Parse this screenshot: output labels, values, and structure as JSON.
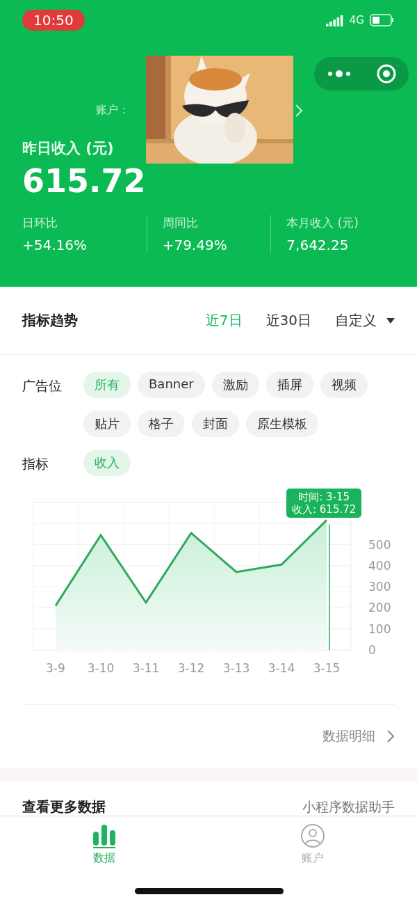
{
  "status_bar": {
    "time": "10:50",
    "network": "4G"
  },
  "header": {
    "account_label": "账户：",
    "yesterday_label": "昨日收入 (元)",
    "yesterday_value": "615.72",
    "stats": [
      {
        "label": "日环比",
        "value": "+54.16%"
      },
      {
        "label": "周同比",
        "value": "+79.49%"
      },
      {
        "label": "本月收入 (元)",
        "value": "7,642.25"
      }
    ]
  },
  "trend": {
    "title": "指标趋势",
    "ranges": [
      {
        "label": "近7日",
        "selected": true
      },
      {
        "label": "近30日",
        "selected": false
      },
      {
        "label": "自定义",
        "selected": false
      }
    ]
  },
  "filters": [
    {
      "label": "广告位",
      "chips": [
        {
          "label": "所有",
          "selected": true
        },
        {
          "label": "Banner",
          "selected": false
        },
        {
          "label": "激励",
          "selected": false
        },
        {
          "label": "插屏",
          "selected": false
        },
        {
          "label": "视频",
          "selected": false
        },
        {
          "label": "贴片",
          "selected": false
        },
        {
          "label": "格子",
          "selected": false
        },
        {
          "label": "封面",
          "selected": false
        },
        {
          "label": "原生模板",
          "selected": false
        }
      ]
    },
    {
      "label": "指标",
      "chips": [
        {
          "label": "收入",
          "selected": true
        }
      ]
    }
  ],
  "chart": {
    "tooltip": [
      "时间: 3-15",
      "收入: 615.72"
    ],
    "chart_data": {
      "type": "area",
      "categories": [
        "3-9",
        "3-10",
        "3-11",
        "3-12",
        "3-13",
        "3-14",
        "3-15"
      ],
      "series": [
        {
          "color": "#2eaa5c",
          "values": [
            210,
            545,
            225,
            555,
            370,
            405,
            616
          ]
        }
      ],
      "ylim": [
        0,
        700
      ],
      "yticks": [
        0,
        100,
        200,
        300,
        400,
        500
      ],
      "grid": true,
      "ref_lines": [
        {
          "axis": "x",
          "value": "3-15",
          "color": "#18b35a"
        }
      ]
    }
  },
  "detail_link": "数据明细",
  "more": {
    "title": "查看更多数据",
    "link": "小程序数据助手"
  },
  "tab_bar": [
    {
      "label": "数据",
      "selected": true,
      "kind": "data"
    },
    {
      "label": "账户",
      "selected": false,
      "kind": "account"
    }
  ]
}
